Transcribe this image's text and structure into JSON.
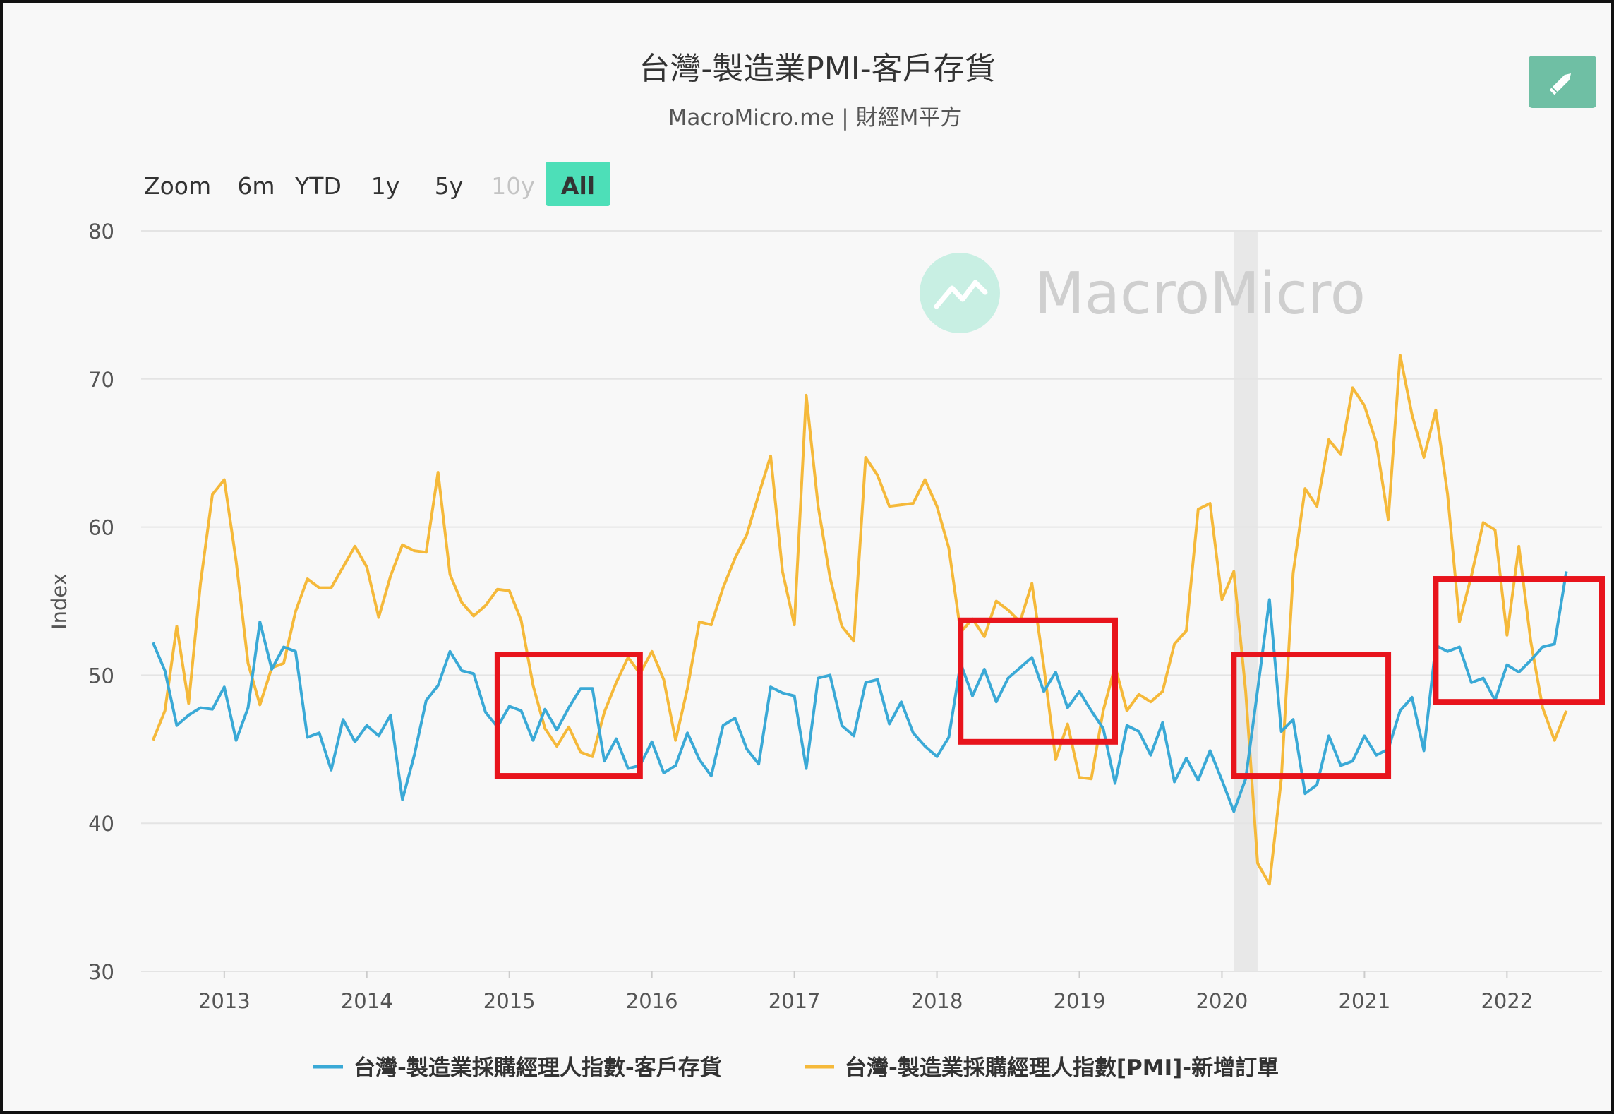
{
  "title": "台灣-製造業PMI-客戶存貨",
  "subtitle": "MacroMicro.me | 財經M平方",
  "watermark": "MacroMicro",
  "zoom": {
    "label": "Zoom",
    "buttons": [
      {
        "label": "6m",
        "state": "normal"
      },
      {
        "label": "YTD",
        "state": "normal"
      },
      {
        "label": "1y",
        "state": "normal"
      },
      {
        "label": "5y",
        "state": "normal"
      },
      {
        "label": "10y",
        "state": "disabled"
      },
      {
        "label": "All",
        "state": "active"
      }
    ]
  },
  "edit_icon": "pencil-icon",
  "colors": {
    "series1": "#3aa9d6",
    "series2": "#f5b93a",
    "active_zoom": "#4ddfb8",
    "edit_button": "#6fbfa4",
    "highlight_box": "#e8141c",
    "recession_band": "#e8e8e8"
  },
  "chart_data": {
    "type": "line",
    "ylabel": "Index",
    "ylim": [
      30,
      80
    ],
    "yticks": [
      30,
      40,
      50,
      60,
      70,
      80
    ],
    "xticks": [
      "2013",
      "2014",
      "2015",
      "2016",
      "2017",
      "2018",
      "2019",
      "2020",
      "2021",
      "2022"
    ],
    "x_start": "2012-07",
    "x_range": [
      "2012-06",
      "2022-09"
    ],
    "shaded_period": [
      "2020-02",
      "2020-04"
    ],
    "highlight_boxes": [
      {
        "x": [
          "2014-12",
          "2015-12"
        ],
        "y": [
          43.2,
          51.4
        ]
      },
      {
        "x": [
          "2018-03",
          "2019-04"
        ],
        "y": [
          45.5,
          53.7
        ]
      },
      {
        "x": [
          "2020-02",
          "2021-03"
        ],
        "y": [
          43.2,
          51.4
        ]
      },
      {
        "x": [
          "2021-07",
          "2022-09"
        ],
        "y": [
          48.2,
          56.5
        ]
      }
    ],
    "series": [
      {
        "name": "台灣-製造業採購經理人指數-客戶存貨",
        "values": [
          52.2,
          50.3,
          46.6,
          47.3,
          47.8,
          47.7,
          49.2,
          45.6,
          47.8,
          53.6,
          50.4,
          51.9,
          51.6,
          45.8,
          46.1,
          43.6,
          47.0,
          45.5,
          46.6,
          45.9,
          47.3,
          41.6,
          44.6,
          48.3,
          49.3,
          51.6,
          50.3,
          50.1,
          47.5,
          46.5,
          47.9,
          47.6,
          45.6,
          47.7,
          46.3,
          47.8,
          49.1,
          49.1,
          44.2,
          45.7,
          43.7,
          43.9,
          45.5,
          43.4,
          43.9,
          46.1,
          44.3,
          43.2,
          46.6,
          47.1,
          45.0,
          44.0,
          49.2,
          48.8,
          48.6,
          43.7,
          49.8,
          50.0,
          46.6,
          45.9,
          49.5,
          49.7,
          46.7,
          48.2,
          46.1,
          45.2,
          44.5,
          45.8,
          50.8,
          48.6,
          50.4,
          48.2,
          49.8,
          50.5,
          51.2,
          48.9,
          50.2,
          47.8,
          48.9,
          47.6,
          46.4,
          42.7,
          46.6,
          46.2,
          44.6,
          46.8,
          42.8,
          44.4,
          42.9,
          44.9,
          42.9,
          40.8,
          43.0,
          49.0,
          55.1,
          46.2,
          47.0,
          42.0,
          42.6,
          45.9,
          43.9,
          44.2,
          45.9,
          44.6,
          45.0,
          47.6,
          48.5,
          44.9,
          52.0,
          51.6,
          51.9,
          49.5,
          49.8,
          48.3,
          50.7,
          50.2,
          51.0,
          51.9,
          52.1,
          57.0
        ]
      },
      {
        "name": "台灣-製造業採購經理人指數[PMI]-新增訂單",
        "values": [
          45.6,
          47.6,
          53.3,
          48.1,
          56.2,
          62.2,
          63.2,
          57.7,
          50.8,
          48.0,
          50.5,
          50.8,
          54.3,
          56.5,
          55.9,
          55.9,
          57.3,
          58.7,
          57.3,
          53.9,
          56.7,
          58.8,
          58.4,
          58.3,
          63.7,
          56.8,
          54.9,
          54.0,
          54.7,
          55.8,
          55.7,
          53.7,
          49.3,
          46.4,
          45.2,
          46.5,
          44.8,
          44.5,
          47.5,
          49.5,
          51.2,
          50.1,
          51.6,
          49.7,
          45.6,
          49.1,
          53.6,
          53.4,
          55.9,
          57.9,
          59.5,
          62.2,
          64.8,
          57.0,
          53.4,
          68.9,
          61.4,
          56.6,
          53.3,
          52.3,
          64.7,
          63.5,
          61.4,
          61.5,
          61.6,
          63.2,
          61.4,
          58.6,
          52.9,
          53.8,
          52.6,
          55.0,
          54.4,
          53.6,
          56.2,
          50.6,
          44.3,
          46.7,
          43.1,
          43.0,
          47.6,
          50.6,
          47.6,
          48.7,
          48.2,
          48.9,
          52.1,
          53.0,
          61.2,
          61.6,
          55.1,
          57.0,
          48.9,
          37.3,
          35.9,
          43.0,
          56.9,
          62.6,
          61.4,
          65.9,
          64.9,
          69.4,
          68.2,
          65.7,
          60.5,
          71.6,
          67.6,
          64.7,
          67.9,
          62.2,
          53.6,
          56.7,
          60.3,
          59.8,
          52.7,
          58.7,
          52.3,
          47.8,
          45.6,
          47.6
        ]
      }
    ]
  }
}
